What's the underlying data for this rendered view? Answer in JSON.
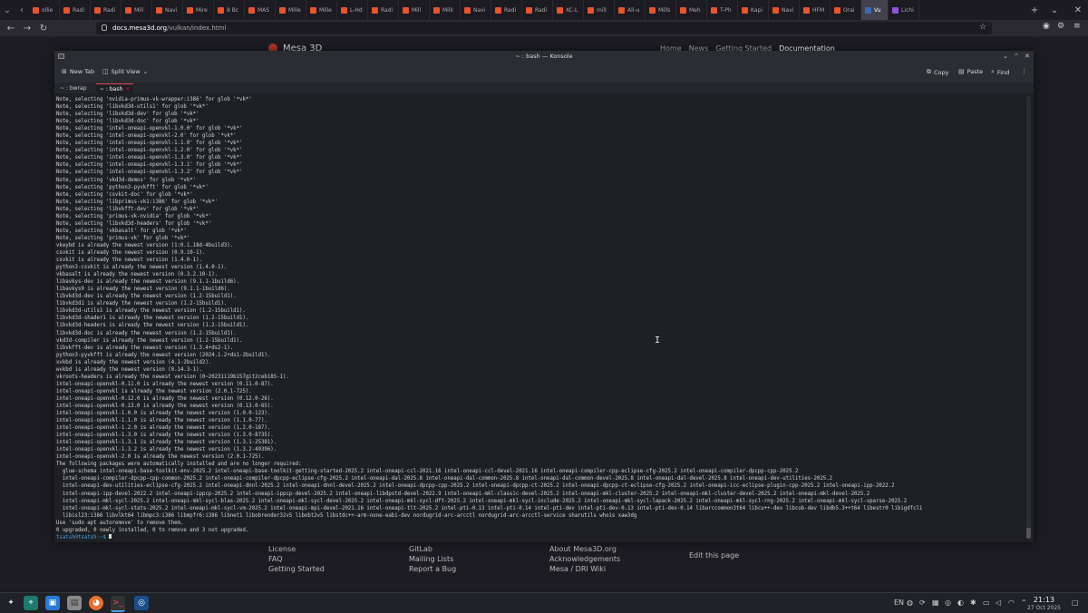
{
  "browser": {
    "tabs": [
      {
        "label": "ollie",
        "kind": "red"
      },
      {
        "label": "Radi",
        "kind": "red"
      },
      {
        "label": "Radi",
        "kind": "red"
      },
      {
        "label": "Mill",
        "kind": "red"
      },
      {
        "label": "Navi",
        "kind": "red"
      },
      {
        "label": "Mire",
        "kind": "red"
      },
      {
        "label": "8 Bc",
        "kind": "red"
      },
      {
        "label": "MAS",
        "kind": "red"
      },
      {
        "label": "Mille",
        "kind": "red"
      },
      {
        "label": "Mille",
        "kind": "red"
      },
      {
        "label": "L-Hd",
        "kind": "red"
      },
      {
        "label": "Radi",
        "kind": "red"
      },
      {
        "label": "Mill",
        "kind": "red"
      },
      {
        "label": "Milk",
        "kind": "red"
      },
      {
        "label": "Navi",
        "kind": "red"
      },
      {
        "label": "Radi",
        "kind": "red"
      },
      {
        "label": "Radi",
        "kind": "red"
      },
      {
        "label": "XC-L",
        "kind": "red"
      },
      {
        "label": "mill",
        "kind": "red"
      },
      {
        "label": "All-u",
        "kind": "red"
      },
      {
        "label": "Mills",
        "kind": "red"
      },
      {
        "label": "Meh",
        "kind": "red"
      },
      {
        "label": "T-Ph",
        "kind": "red"
      },
      {
        "label": "Kapi",
        "kind": "red"
      },
      {
        "label": "Navi",
        "kind": "red"
      },
      {
        "label": "HFM",
        "kind": "red"
      },
      {
        "label": "Orai",
        "kind": "red"
      },
      {
        "label": "Vu",
        "kind": "active"
      },
      {
        "label": "Lichi",
        "kind": "purple"
      }
    ],
    "url_host": "docs.mesa3d.org",
    "url_path": "/vulkan/index.html"
  },
  "website": {
    "title": "Mesa 3D",
    "nav": [
      "Home",
      "News",
      "Getting Started",
      "Documentation"
    ],
    "footer": {
      "col1": [
        "License",
        "FAQ",
        "Getting Started"
      ],
      "col2": [
        "GitLab",
        "Mailing Lists",
        "Report a Bug"
      ],
      "col3": [
        "About Mesa3D.org",
        "Acknowledgements",
        "Mesa / DRI Wiki"
      ],
      "edit": "Edit this page"
    }
  },
  "konsole": {
    "title": "~ : bash — Konsole",
    "toolbar": {
      "new_tab": "New Tab",
      "split_view": "Split View",
      "copy": "Copy",
      "paste": "Paste",
      "find": "Find"
    },
    "tabs": [
      {
        "label": "~ : bwrap"
      },
      {
        "label": "~ : bash"
      }
    ],
    "prompt": "tsatsh@tsatsh:~$ ",
    "lines": [
      "Note, selecting 'nvidia-primus-vk-wrapper:i386' for glob '*vk*'",
      "Note, selecting 'libvkd3d-utils1' for glob '*vk*'",
      "Note, selecting 'libvkd3d-dev' for glob '*vk*'",
      "Note, selecting 'libvkd3d-doc' for glob '*vk*'",
      "Note, selecting 'intel-oneapi-openvkl-1.0.0' for glob '*vk*'",
      "Note, selecting 'intel-oneapi-openvkl-2.0' for glob '*vk*'",
      "Note, selecting 'intel-oneapi-openvkl-1.1.0' for glob '*vk*'",
      "Note, selecting 'intel-oneapi-openvkl-1.2.0' for glob '*vk*'",
      "Note, selecting 'intel-oneapi-openvkl-1.3.0' for glob '*vk*'",
      "Note, selecting 'intel-oneapi-openvkl-1.3.1' for glob '*vk*'",
      "Note, selecting 'intel-oneapi-openvkl-1.3.2' for glob '*vk*'",
      "Note, selecting 'vkd3d-demos' for glob '*vk*'",
      "Note, selecting 'python3-pyvkfft' for glob '*vk*'",
      "Note, selecting 'csvkit-doc' for glob '*vk*'",
      "Note, selecting 'libprimus-vk1:i386' for glob '*vk*'",
      "Note, selecting 'libvkfft-dev' for glob '*vk*'",
      "Note, selecting 'primus-vk-nvidia' for glob '*vk*'",
      "Note, selecting 'libvkd3d-headers' for glob '*vk*'",
      "Note, selecting 'vkbasalt' for glob '*vk*'",
      "Note, selecting 'primus-vk' for glob '*vk*'",
      "vkeybd is already the newest version (1:0.1.18d-4build3).",
      "csvkit is already the newest version (0.9.10-1).",
      "csvkit is already the newest version (1.4.0-1).",
      "python3-csvkit is already the newest version (1.4.0-1).",
      "vkbasalt is already the newest version (0.3.2.10-1).",
      "libavkys-dev is already the newest version (9.1.1-1build6).",
      "libavkys9 is already the newest version (9.1.1-1build6).",
      "libvkd3d-dev is already the newest version (1.2-15build1).",
      "libvkd3d1 is already the newest version (1.2-15build1).",
      "libvkd3d-utils1 is already the newest version (1.2-15build1).",
      "libvkd3d-shader1 is already the newest version (1.2-15build1).",
      "libvkd3d-headers is already the newest version (1.2-15build1).",
      "libvkd3d-doc is already the newest version (1.2-15build1).",
      "vkd3d-compiler is already the newest version (1.2-15build1).",
      "libvkfft-dev is already the newest version (1.3.4+ds2-1).",
      "python3-pyvkfft is already the newest version (2024.1.2+ds1-2build1).",
      "xvkbd is already the newest version (4.1-2build2).",
      "wvkbd is already the newest version (0.14.3-1).",
      "vkroots-headers is already the newest version (0~20231119b157git2ceb185-1).",
      "intel-oneapi-openvkl-0.11.0 is already the newest version (0.11.0-87).",
      "intel-oneapi-openvkl is already the newest version (2.0.1-725).",
      "intel-oneapi-openvkl-0.12.0 is already the newest version (0.12.0-26).",
      "intel-oneapi-openvkl-0.13.0 is already the newest version (0.13.0-65).",
      "intel-oneapi-openvkl-1.0.0 is already the newest version (1.0.0-123).",
      "intel-oneapi-openvkl-1.1.0 is already the newest version (1.1.0-77).",
      "intel-oneapi-openvkl-1.2.0 is already the newest version (1.2.0-187).",
      "intel-oneapi-openvkl-1.3.0 is already the newest version (1.3.0-8735).",
      "intel-oneapi-openvkl-1.3.1 is already the newest version (1.3.1-25381).",
      "intel-oneapi-openvkl-1.3.2 is already the newest version (1.3.2-49396).",
      "intel-oneapi-openvkl-2.0 is already the newest version (2.0.1-725).",
      "The following packages were automatically installed and are no longer required:",
      "  glue-schema intel-oneapi-base-toolkit-env-2025.2 intel-oneapi-base-toolkit-getting-started-2025.2 intel-oneapi-ccl-2021.16 intel-oneapi-ccl-devel-2021.16 intel-oneapi-compiler-cpp-eclipse-cfg-2025.2 intel-oneapi-compiler-dpcpp-cpp-2025.2",
      "  intel-oneapi-compiler-dpcpp-cpp-common-2025.2 intel-oneapi-compiler-dpcpp-eclipse-cfg-2025.2 intel-oneapi-dal-2025.8 intel-oneapi-dal-common-2025.8 intel-oneapi-dal-common-devel-2025.8 intel-oneapi-dal-devel-2025.8 intel-oneapi-dev-utilities-2025.2",
      "  intel-oneapi-dev-utilities-eclipse-cfg-2025.2 intel-oneapi-dnnl-2025.2 intel-oneapi-dnnl-devel-2025.2 intel-oneapi-dpcpp-cpp-2025.2 intel-oneapi-dpcpp-ct-2025.2 intel-oneapi-dpcpp-ct-eclipse-cfg-2025.2 intel-oneapi-icc-eclipse-plugin-cpp-2025.2 intel-oneapi-ipp-2022.2",
      "  intel-oneapi-ipp-devel-2022.2 intel-oneapi-ippcp-2025.2 intel-oneapi-ippcp-devel-2025.2 intel-oneapi-libdpstd-devel-2022.9 intel-oneapi-mkl-classic-devel-2025.2 intel-oneapi-mkl-cluster-2025.2 intel-oneapi-mkl-cluster-devel-2025.2 intel-oneapi-mkl-devel-2025.2",
      "  intel-oneapi-mkl-sycl-2025.2 intel-oneapi-mkl-sycl-blas-2025.2 intel-oneapi-mkl-sycl-devel-2025.2 intel-oneapi-mkl-sycl-dft-2025.2 intel-oneapi-mkl-sycl-include-2025.2 intel-oneapi-mkl-sycl-lapack-2025.2 intel-oneapi-mkl-sycl-rng-2025.2 intel-oneapi-mkl-sycl-sparse-2025.2",
      "  intel-oneapi-mkl-sycl-stats-2025.2 intel-oneapi-mkl-sycl-vm-2025.2 intel-oneapi-mpi-devel-2021.16 intel-oneapi-tlt-2025.2 intel-pti-0.13 intel-pti-0.14 intel-pti-dev intel-pti-dev-0.13 intel-pti-dev-0.14 libarccommon3t64 libcu++-dev libcub-dev libdb5.3++t64 libestr0 libigdfcl1",
      "  libisl23:i386 libvlkt64 libmpc3:i386 libmpfr6:i386 libnet1 libobrender32v5 libobt2v5 libstdc++-arm-none-eabi-dev nordugrid-arc-arcctl nordugrid-arc-arcctl-service sharutils whois xaw3dg",
      "Use 'sudo apt autoremove' to remove them.",
      "0 upgraded, 0 newly installed, 0 to remove and 3 not upgraded."
    ]
  },
  "taskbar": {
    "lang": "EN",
    "time": "21:13",
    "date": "27 Oct 2025"
  },
  "colors": {
    "accent_red": "#e34a63",
    "prompt_blue": "#4a9fe6",
    "terminal_bg": "#1e2024"
  }
}
